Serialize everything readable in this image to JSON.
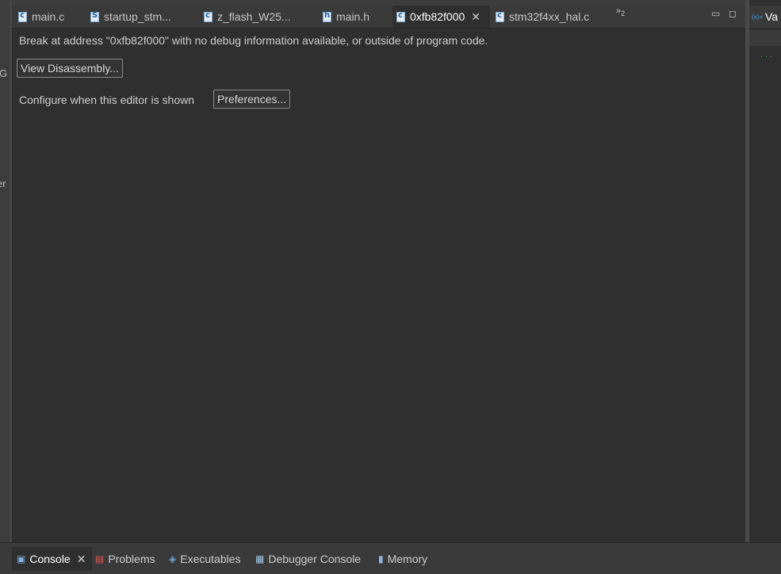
{
  "left_view": {
    "fragments": [
      "G",
      "er"
    ]
  },
  "editor": {
    "tabs": [
      {
        "label": "main.c",
        "icon": "c",
        "active": false
      },
      {
        "label": "startup_stm...",
        "icon": "S",
        "active": false
      },
      {
        "label": "z_flash_W25...",
        "icon": "c",
        "active": false
      },
      {
        "label": "main.h",
        "icon": "h",
        "active": false
      },
      {
        "label": "0xfb82f000",
        "icon": "c",
        "active": true,
        "closable": true
      },
      {
        "label": "stm32f4xx_hal.c",
        "icon": "c",
        "active": false
      }
    ],
    "overflow_count": "2",
    "message": "Break at address \"0xfb82f000\" with no debug information available, or outside of program code.",
    "view_disassembly_label": "View Disassembly...",
    "configure_label": "Configure when this editor is shown",
    "preferences_label": "Preferences..."
  },
  "right_view": {
    "tab_label": "Va",
    "icon_text": "(x)="
  },
  "bottom_panel": {
    "tabs": [
      {
        "label": "Console",
        "active": true,
        "closable": true,
        "icon": "console-icon"
      },
      {
        "label": "Problems",
        "active": false,
        "icon": "problems-icon"
      },
      {
        "label": "Executables",
        "active": false,
        "icon": "executables-icon"
      },
      {
        "label": "Debugger Console",
        "active": false,
        "icon": "debugger-console-icon"
      },
      {
        "label": "Memory",
        "active": false,
        "icon": "memory-icon"
      }
    ]
  }
}
